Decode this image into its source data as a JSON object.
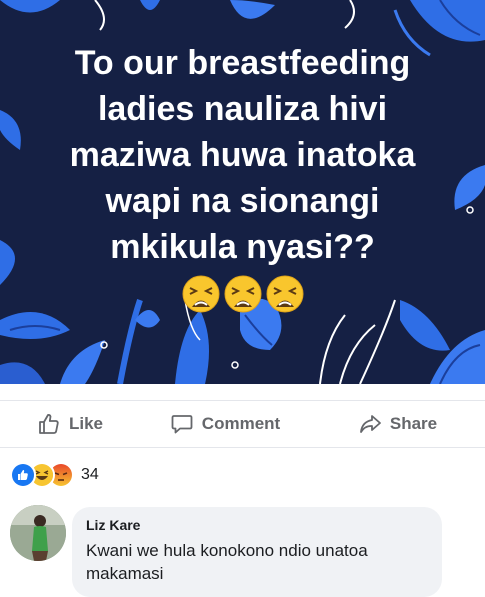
{
  "post": {
    "text": "To our breastfeeding\nladies nauliza hivi\nmaziwa huwa inatoka\nwapi na sionangi\nmkikula nyasi??",
    "emojis": [
      "weary-face",
      "weary-face",
      "weary-face"
    ],
    "background_color": "#152044",
    "accent_color": "#2f6ee6"
  },
  "actions": {
    "like_label": "Like",
    "comment_label": "Comment",
    "share_label": "Share"
  },
  "reactions": {
    "icons": [
      "like-reaction",
      "haha-reaction",
      "angry-reaction"
    ],
    "count": "34"
  },
  "comment": {
    "author": "Liz Kare",
    "text": "Kwani we hula konokono ndio unatoa makamasi"
  }
}
